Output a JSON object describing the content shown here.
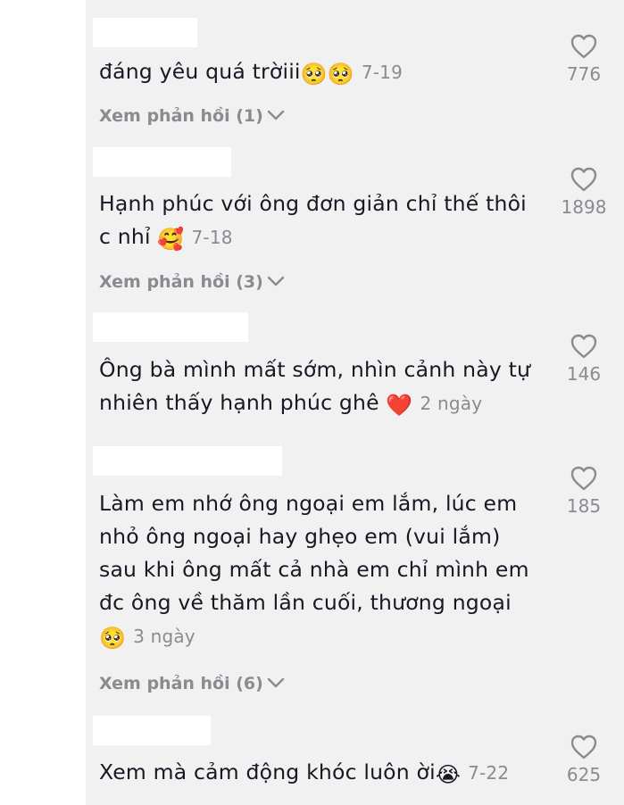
{
  "comments": [
    {
      "text": "đáng yêu quá trờiii",
      "emoji": "🥺🥺",
      "date": "7-19",
      "likes": "776",
      "replies": "Xem phản hồi (1)"
    },
    {
      "text": "Hạnh phúc với ông đơn giản chỉ thế thôi c nhỉ",
      "emoji": "🥰",
      "date": "7-18",
      "likes": "1898",
      "replies": "Xem phản hồi (3)"
    },
    {
      "text": "Ông bà mình mất sớm, nhìn cảnh này tự nhiên thấy hạnh phúc ghê",
      "emoji": "❤️",
      "date": "2 ngày",
      "likes": "146"
    },
    {
      "text": "Làm em nhớ ông ngoại em lắm, lúc em nhỏ ông ngoại hay ghẹo em (vui lắm) sau khi ông mất cả nhà em chỉ mình em đc ông về thăm lần cuối, thương ngoại",
      "emoji": "🥺",
      "date": "3 ngày",
      "likes": "185",
      "replies": "Xem phản hồi (6)"
    },
    {
      "text": "Xem mà cảm động khóc luôn ời",
      "emoji": "😭",
      "date": "7-22",
      "likes": "625"
    }
  ],
  "icons": {
    "like": "heart-outline-icon",
    "expand": "chevron-down-icon"
  },
  "colors": {
    "background": "#f1f1f2",
    "text": "#161823",
    "secondary": "#8a8b91"
  }
}
